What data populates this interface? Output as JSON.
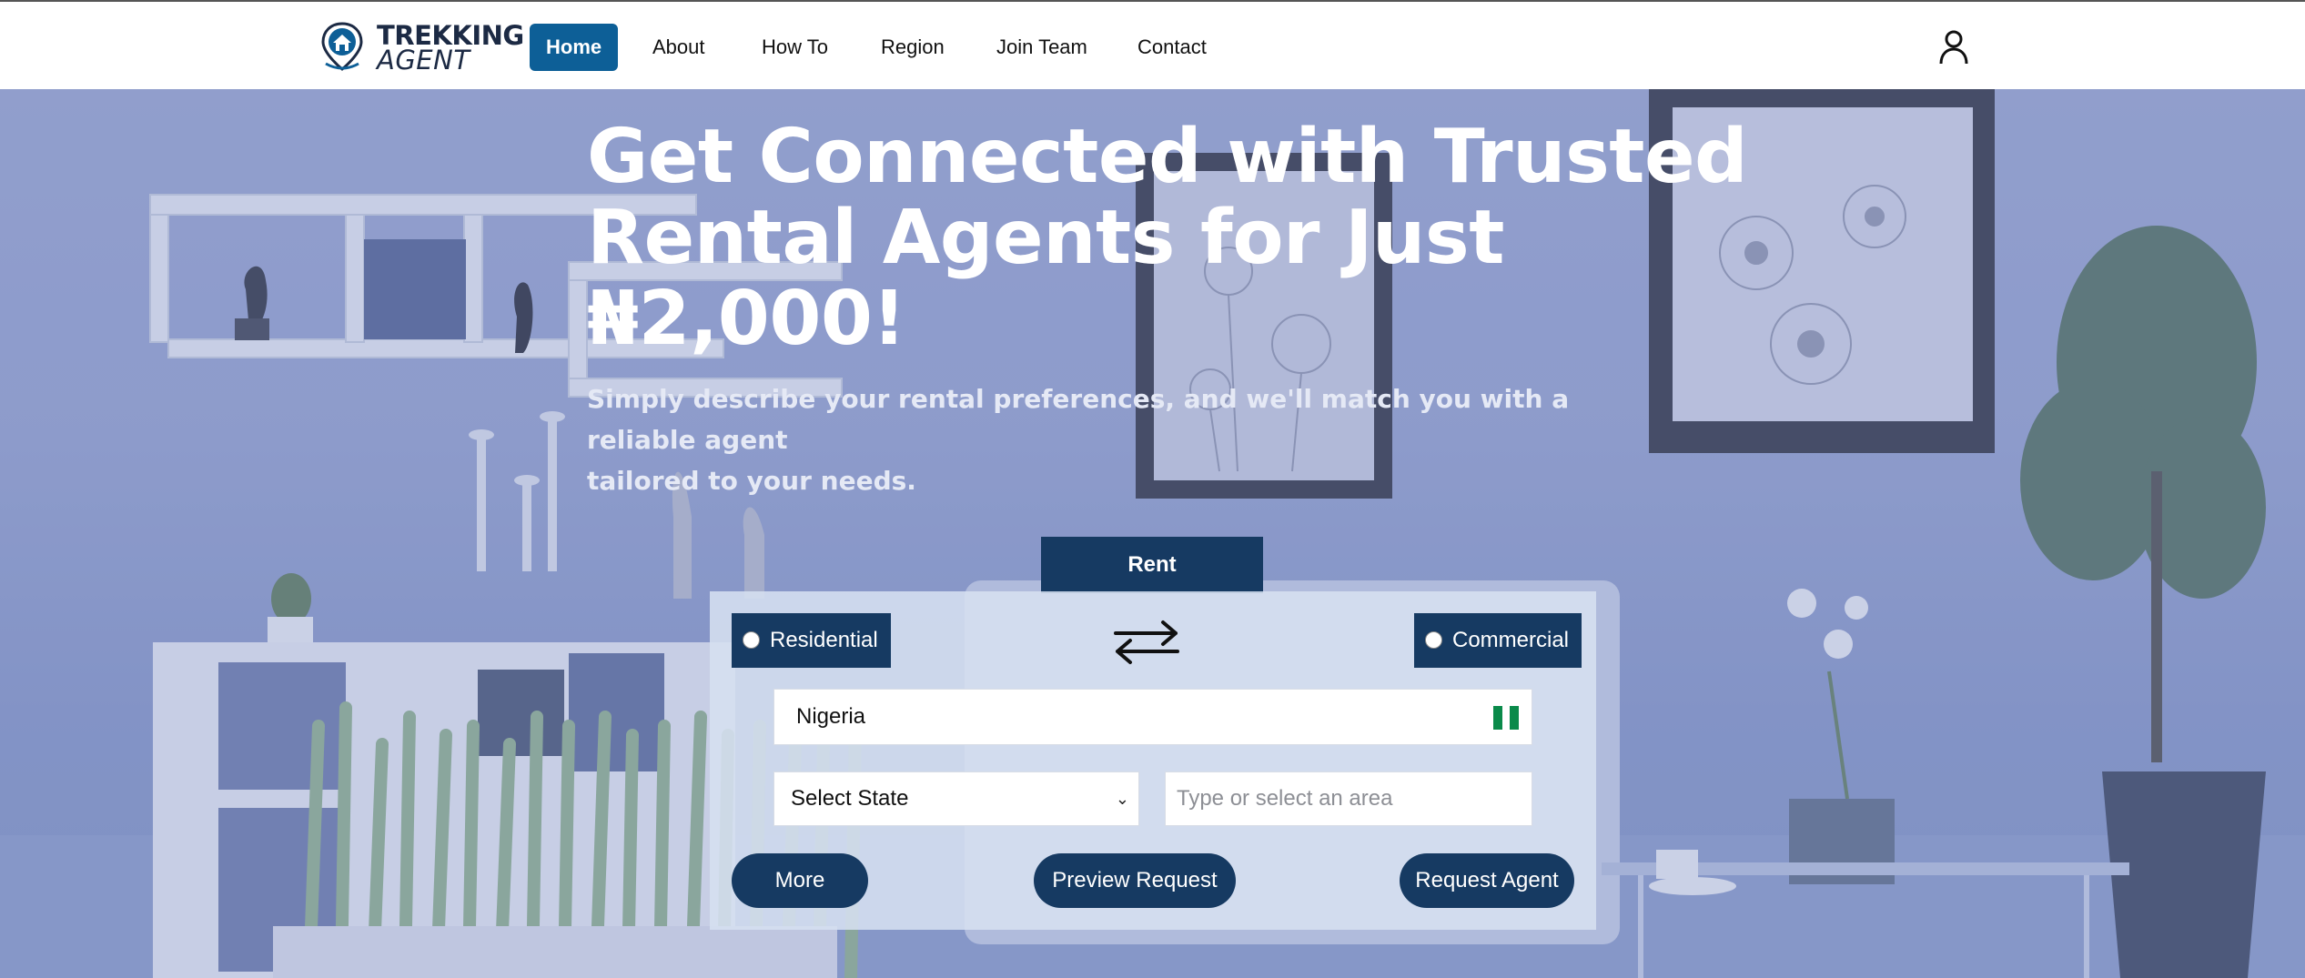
{
  "brand": {
    "name_line1": "TREKKING",
    "name_line2": "AGENT",
    "accent_color": "#0d5f97",
    "dark_color": "#163a62"
  },
  "nav": {
    "items": [
      {
        "label": "Home",
        "active": true
      },
      {
        "label": "About",
        "active": false
      },
      {
        "label": "How To",
        "active": false
      },
      {
        "label": "Region",
        "active": false
      },
      {
        "label": "Join Team",
        "active": false
      },
      {
        "label": "Contact",
        "active": false
      }
    ],
    "user_icon": "user-icon"
  },
  "hero": {
    "headline_line1": "Get Connected with Trusted",
    "headline_line2": "Rental Agents for Just",
    "headline_line3": "₦2,000!",
    "subtitle_line1": "Simply describe your rental preferences, and we'll match you with a reliable agent",
    "subtitle_line2": "tailored to your needs."
  },
  "search": {
    "tab_label": "Rent",
    "type_options": [
      "Residential",
      "Commercial"
    ],
    "swap_icon": "swap-arrows-icon",
    "country_value": "Nigeria",
    "country_flag": "nigeria-flag-icon",
    "state_selected": "Select State",
    "area_placeholder": "Type or select an area",
    "buttons": {
      "more": "More",
      "preview": "Preview Request",
      "request": "Request Agent"
    }
  }
}
